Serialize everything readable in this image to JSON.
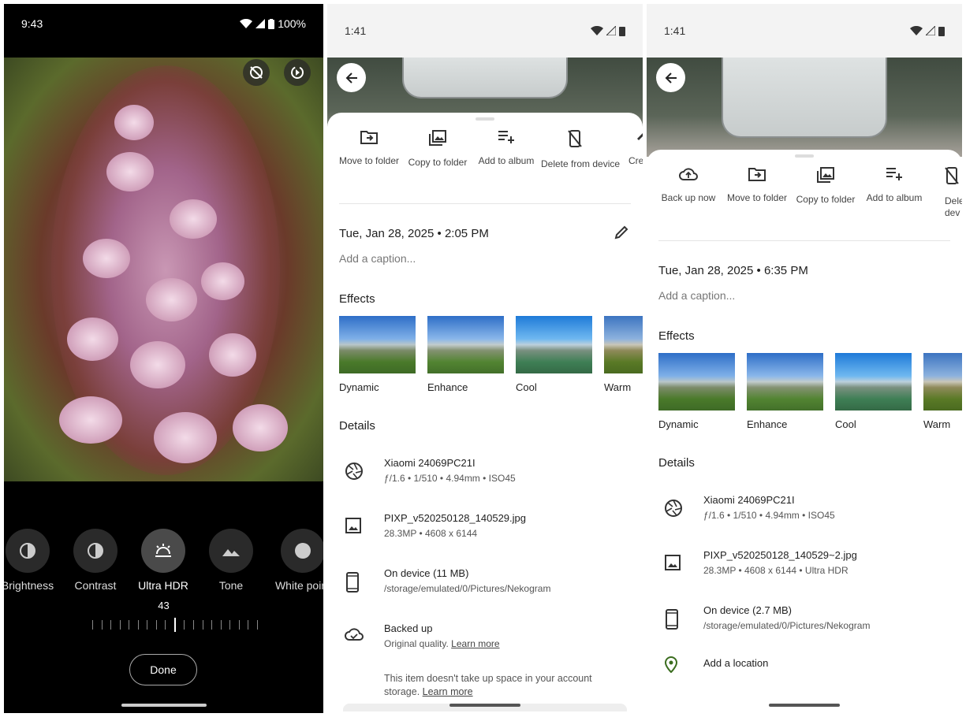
{
  "editor": {
    "time": "9:43",
    "battery": "100%",
    "tools": [
      {
        "label": "Brightness",
        "icon": "brightness-icon"
      },
      {
        "label": "Contrast",
        "icon": "contrast-icon"
      },
      {
        "label": "Ultra HDR",
        "icon": "hdr-icon"
      },
      {
        "label": "Tone",
        "icon": "tone-icon"
      },
      {
        "label": "White point",
        "icon": "white-point-icon"
      }
    ],
    "active_tool": "Ultra HDR",
    "slider_value": "43",
    "done_label": "Done"
  },
  "info_a": {
    "time": "1:41",
    "actions": [
      {
        "label": "Move to folder"
      },
      {
        "label": "Copy to folder"
      },
      {
        "label": "Add to album"
      },
      {
        "label": "Delete from device"
      },
      {
        "label": "Cre"
      }
    ],
    "datetime": "Tue, Jan 28, 2025  •  2:05 PM",
    "caption_placeholder": "Add a caption...",
    "effects_title": "Effects",
    "effects": [
      "Dynamic",
      "Enhance",
      "Cool",
      "Warm"
    ],
    "details_title": "Details",
    "camera": {
      "model": "Xiaomi 24069PC21I",
      "specs": "ƒ/1.6  •  1/510  •  4.94mm  •  ISO45"
    },
    "file": {
      "name": "PIXP_v520250128_140529.jpg",
      "specs": "28.3MP  •  4608 x 6144"
    },
    "storage": {
      "title": "On device (11 MB)",
      "path": "/storage/emulated/0/Pictures/Nekogram"
    },
    "backup": {
      "title": "Backed up",
      "text": "Original quality.",
      "link": "Learn more"
    },
    "space_note": {
      "text": "This item doesn't take up space in your account storage.",
      "link": "Learn more"
    }
  },
  "info_b": {
    "time": "1:41",
    "actions": [
      {
        "label": "Back up now"
      },
      {
        "label": "Move to folder"
      },
      {
        "label": "Copy to folder"
      },
      {
        "label": "Add to album"
      },
      {
        "label": "Delete dev"
      }
    ],
    "datetime": "Tue, Jan 28, 2025  •  6:35 PM",
    "caption_placeholder": "Add a caption...",
    "effects_title": "Effects",
    "effects": [
      "Dynamic",
      "Enhance",
      "Cool",
      "Warm"
    ],
    "details_title": "Details",
    "camera": {
      "model": "Xiaomi 24069PC21I",
      "specs": "ƒ/1.6  •  1/510  •  4.94mm  •  ISO45"
    },
    "file": {
      "name": "PIXP_v520250128_140529~2.jpg",
      "specs": "28.3MP  •  4608 x 6144  •  Ultra HDR"
    },
    "storage": {
      "title": "On device (2.7 MB)",
      "path": "/storage/emulated/0/Pictures/Nekogram"
    },
    "location": "Add a location"
  },
  "colors": {
    "accent_green": "#3b6d1f",
    "editor_bg": "#000000"
  }
}
